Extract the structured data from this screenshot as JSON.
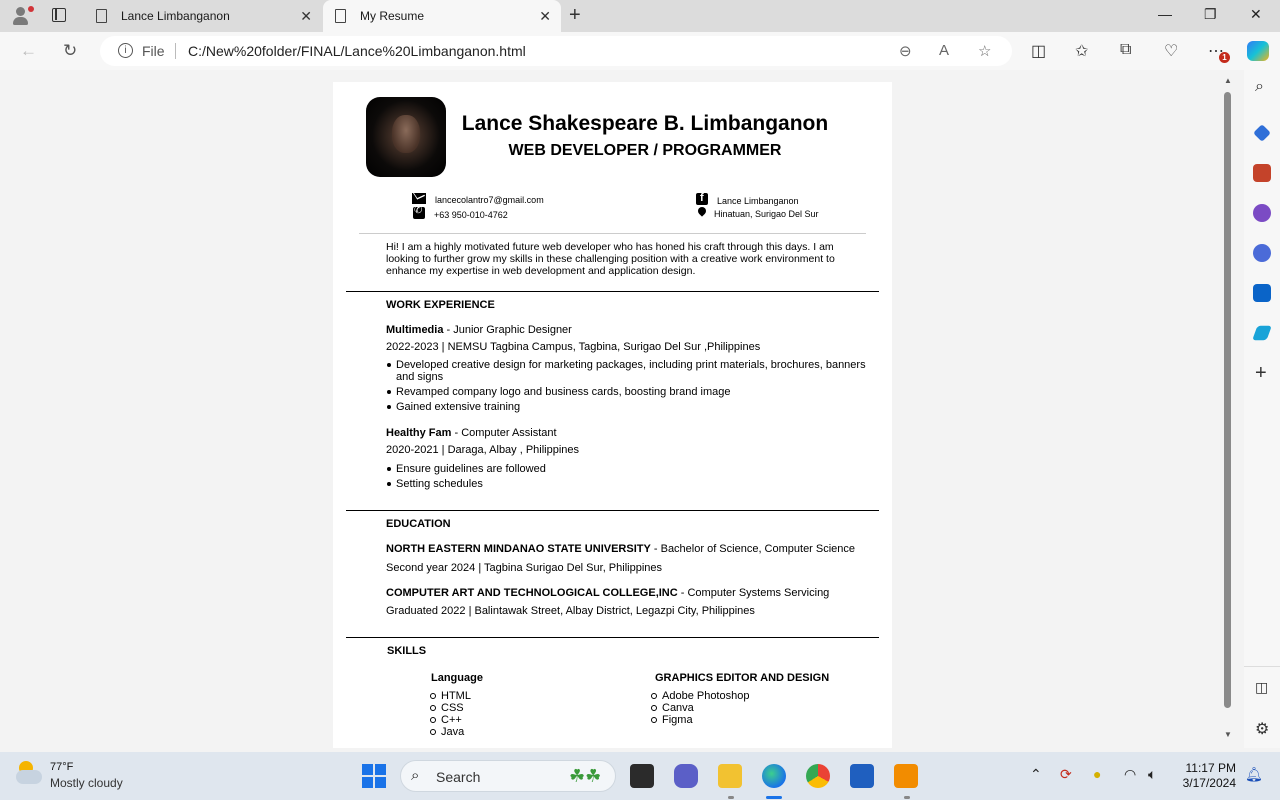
{
  "browser": {
    "tabs": [
      {
        "title": "Lance Limbanganon",
        "active": false
      },
      {
        "title": "My Resume",
        "active": true
      }
    ],
    "address": {
      "scheme_label": "File",
      "url": "C:/New%20folder/FINAL/Lance%20Limbanganon.html"
    },
    "notification_count": "1"
  },
  "resume": {
    "name": "Lance Shakespeare B. Limbanganon",
    "role": "WEB DEVELOPER / PROGRAMMER",
    "contact": {
      "email": "lancecolantro7@gmail.com",
      "phone": "+63 950-010-4762",
      "facebook": "Lance Limbanganon",
      "location": "Hinatuan, Surigao Del Sur"
    },
    "summary": "Hi! I am a highly motivated future web developer who has honed his craft through this days. I am looking to further grow my skills in these challenging position with a creative work environment to enhance my expertise in web development and application design.",
    "work": {
      "title": "WORK EXPERIENCE",
      "jobs": [
        {
          "company": "Multimedia",
          "position": " - Junior Graphic Designer",
          "details": "2022-2023 | NEMSU Tagbina Campus, Tagbina, Surigao Del Sur ,Philippines",
          "bullets": [
            "Developed creative design for marketing packages, including print materials, brochures, banners and signs",
            "Revamped company logo and business cards, boosting brand image",
            "Gained extensive training"
          ]
        },
        {
          "company": "Healthy Fam",
          "position": " - Computer Assistant",
          "details": "2020-2021 | Daraga, Albay , Philippines",
          "bullets": [
            "Ensure guidelines are followed",
            "Setting schedules"
          ]
        }
      ]
    },
    "education": {
      "title": "EDUCATION",
      "schools": [
        {
          "school": "NORTH EASTERN MINDANAO STATE UNIVERSITY",
          "program": " - Bachelor of Science, Computer Science",
          "details": "Second year 2024 | Tagbina Surigao Del Sur, Philippines"
        },
        {
          "school": "COMPUTER ART AND TECHNOLOGICAL COLLEGE,INC",
          "program": " - Computer Systems Servicing",
          "details": "Graduated 2022 | Balintawak Street, Albay District, Legazpi City, Philippines"
        }
      ]
    },
    "skills": {
      "title": "SKILLS",
      "language_title": "Language",
      "languages": [
        "HTML",
        "CSS",
        "C++",
        "Java"
      ],
      "graphics_title": "GRAPHICS EDITOR AND DESIGN",
      "graphics": [
        "Adobe Photoshop",
        "Canva",
        "Figma"
      ]
    }
  },
  "taskbar": {
    "weather_temp": "77°F",
    "weather_condition": "Mostly cloudy",
    "search_placeholder": "Search",
    "time": "11:17 PM",
    "date": "3/17/2024"
  },
  "colors": {
    "edge_accent": "#1a73e8",
    "notification_red": "#c42b1c"
  }
}
